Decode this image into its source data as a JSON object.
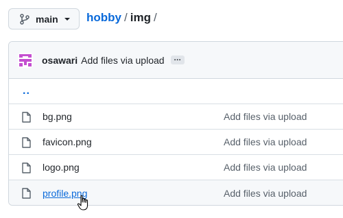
{
  "branch": {
    "name": "main",
    "icon": "git-branch-icon"
  },
  "breadcrumb": {
    "repo": "hobby",
    "sep1": "/",
    "dir": "img",
    "sep2": "/"
  },
  "commit": {
    "author": "osawari",
    "message": "Add files via upload",
    "ellipsis": "…"
  },
  "parent_dir": "..",
  "files": [
    {
      "name": "bg.png",
      "commit": "Add files via upload"
    },
    {
      "name": "favicon.png",
      "commit": "Add files via upload"
    },
    {
      "name": "logo.png",
      "commit": "Add files via upload"
    },
    {
      "name": "profile.png",
      "commit": "Add files via upload"
    }
  ],
  "colors": {
    "link": "#0969da",
    "muted": "#57606a",
    "border": "#d0d7de",
    "header_bg": "#f6f8fa",
    "avatar": "#c44fd0"
  }
}
